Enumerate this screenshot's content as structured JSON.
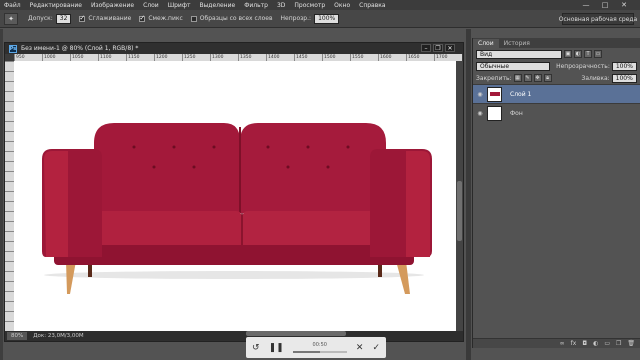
{
  "menubar": {
    "items": [
      "Файл",
      "Редактирование",
      "Изображение",
      "Слои",
      "Шрифт",
      "Выделение",
      "Фильтр",
      "3D",
      "Просмотр",
      "Окно",
      "Справка"
    ]
  },
  "window_controls": {
    "minimize": "—",
    "maximize": "□",
    "close": "✕"
  },
  "options": {
    "tolerance_label": "Допуск:",
    "tolerance_value": "32",
    "antialias_label": "Сглаживание",
    "contiguous_label": "Смеж.пикс",
    "sample_all_label": "Образцы со всех слоев",
    "opacity_label": "Непрозр.:",
    "opacity_value": "100%",
    "workspace": "Основная рабочая среда"
  },
  "document": {
    "title": "Без имени-1 @ 80% (Слой 1, RGB/8) *",
    "ps_logo": "Ps",
    "ruler_ticks": [
      "950",
      "1000",
      "1050",
      "1100",
      "1150",
      "1200",
      "1250",
      "1300",
      "1350",
      "1400",
      "1450",
      "1500",
      "1550",
      "1600",
      "1650",
      "1700"
    ],
    "zoom": "80%",
    "doc_info": "Док: 23,0M/3,00M"
  },
  "layers_panel": {
    "tabs": [
      "Слои",
      "История"
    ],
    "filter_label": "Вид",
    "blend_mode": "Обычные",
    "opacity_label": "Непрозрачность:",
    "opacity_value": "100%",
    "lock_label": "Закрепить:",
    "fill_label": "Заливка:",
    "fill_value": "100%",
    "layers": [
      {
        "name": "Слой 1",
        "selected": true
      },
      {
        "name": "Фон",
        "selected": false
      }
    ],
    "bottom_icons": [
      "link-icon",
      "fx-icon",
      "mask-icon",
      "adjustment-icon",
      "folder-icon",
      "new-layer-icon",
      "trash-icon"
    ]
  },
  "player": {
    "time": "00:50",
    "progress": 0.5
  },
  "colors": {
    "sofa": "#a3193a",
    "sofa_dark": "#7e1029",
    "legs": "#d49a5c",
    "selection": "#5a7197"
  }
}
